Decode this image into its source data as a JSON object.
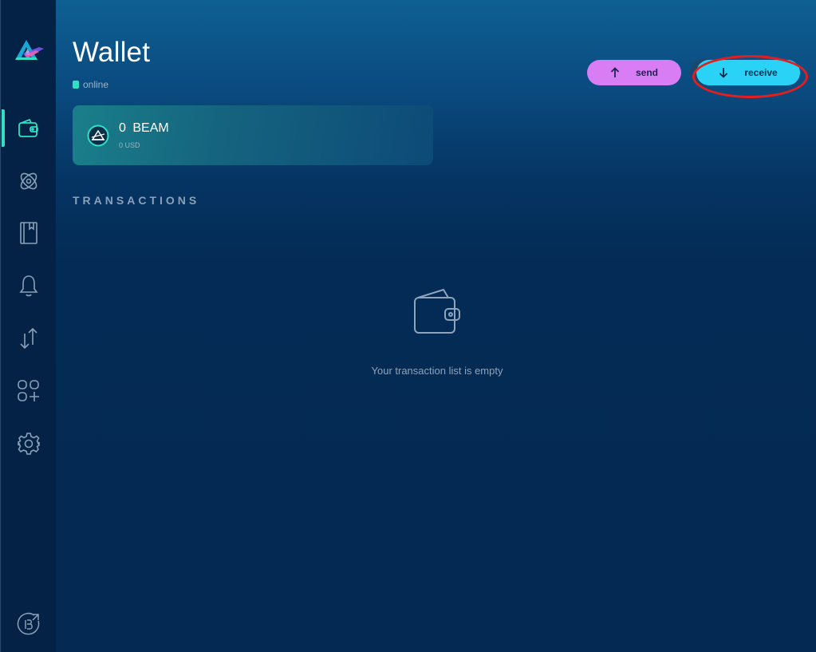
{
  "page": {
    "title": "Wallet",
    "status": "online"
  },
  "sidebar": {
    "items": [
      {
        "name": "wallet",
        "icon": "wallet-icon",
        "active": true
      },
      {
        "name": "atomic-swap",
        "icon": "atom-icon",
        "active": false
      },
      {
        "name": "address-book",
        "icon": "notebook-icon",
        "active": false
      },
      {
        "name": "notifications",
        "icon": "bell-icon",
        "active": false
      },
      {
        "name": "transfer",
        "icon": "transfer-arrows-icon",
        "active": false
      },
      {
        "name": "applications",
        "icon": "apps-plus-icon",
        "active": false
      },
      {
        "name": "settings",
        "icon": "gear-icon",
        "active": false
      }
    ],
    "footer_icon": "beam-explorer-external-icon"
  },
  "actions": {
    "send_label": "send",
    "receive_label": "receive"
  },
  "balance": {
    "amount": "0",
    "currency": "BEAM",
    "fiat": "0 USD"
  },
  "transactions": {
    "heading": "TRANSACTIONS",
    "empty_text": "Your transaction list is empty"
  },
  "colors": {
    "accent": "#2fe0c4",
    "send": "#d87df3",
    "receive": "#2ad3f6",
    "highlight_ring": "#e21f1f"
  }
}
